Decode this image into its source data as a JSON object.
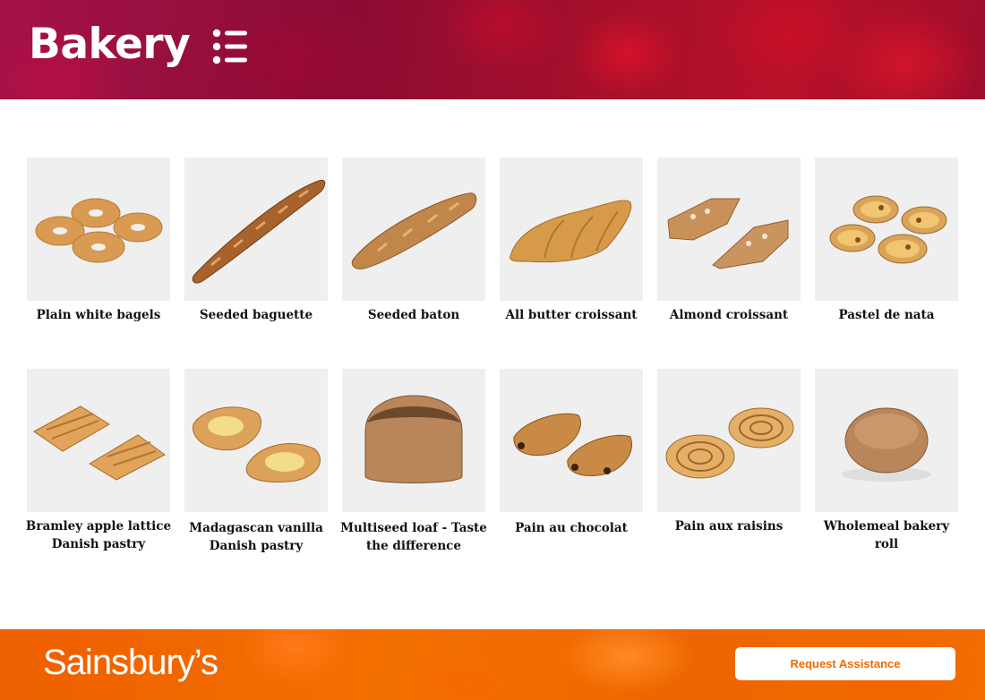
{
  "header": {
    "title": "Bakery",
    "menu_icon": "list-menu-icon"
  },
  "products": [
    {
      "name": "Plain white bagels",
      "icon": "bagels-image"
    },
    {
      "name": "Seeded baguette",
      "icon": "baguette-image"
    },
    {
      "name": "Seeded baton",
      "icon": "baton-image"
    },
    {
      "name": "All butter croissant",
      "icon": "croissant-image"
    },
    {
      "name": "Almond croissant",
      "icon": "almond-croissant-image"
    },
    {
      "name": "Pastel de nata",
      "icon": "pastel-de-nata-image"
    },
    {
      "name": "Bramley apple lattice Danish pastry",
      "icon": "apple-lattice-image"
    },
    {
      "name": "Madagascan vanilla Danish pastry",
      "icon": "vanilla-danish-image"
    },
    {
      "name": "Multiseed loaf - Taste the difference",
      "icon": "multiseed-loaf-image"
    },
    {
      "name": "Pain au chocolat",
      "icon": "pain-au-chocolat-image"
    },
    {
      "name": "Pain aux raisins",
      "icon": "pain-aux-raisins-image"
    },
    {
      "name": "Wholemeal bakery roll",
      "icon": "wholemeal-roll-image"
    }
  ],
  "footer": {
    "brand": "Sainsbury’s",
    "assist_label": "Request Assistance"
  },
  "colors": {
    "header_accent": "#a3113c",
    "footer_accent": "#f06c00",
    "button_text": "#ef6a00",
    "label_text": "#111111"
  }
}
